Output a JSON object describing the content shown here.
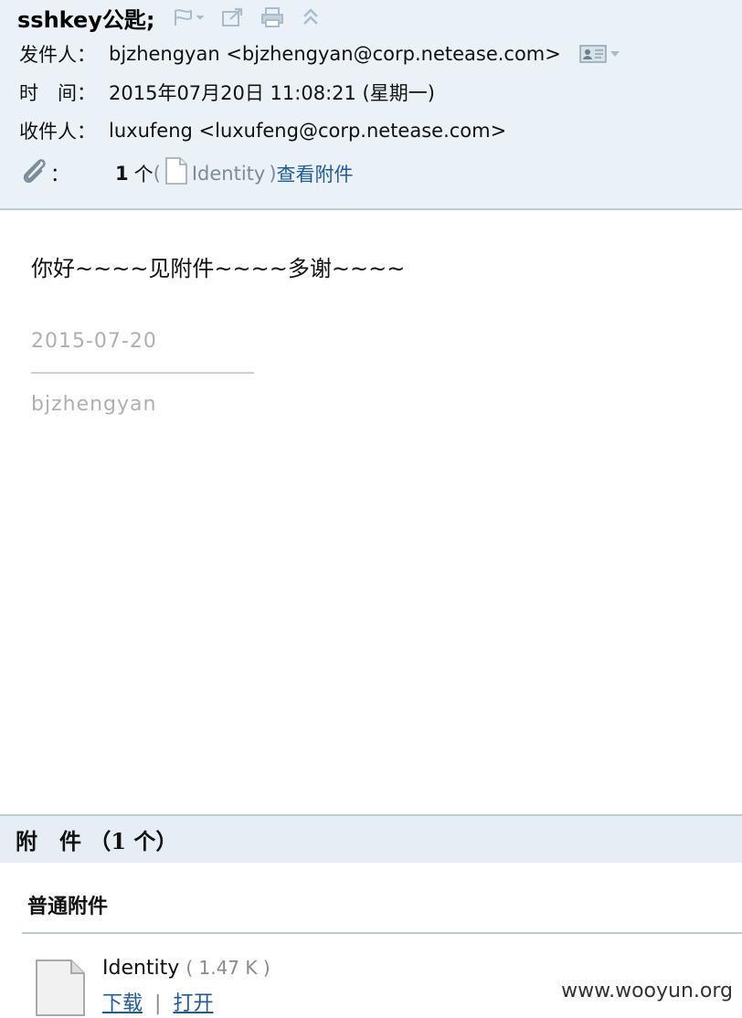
{
  "header": {
    "subject": "sshkey公匙;",
    "toolbar": {
      "flag_icon": "flag-icon",
      "popout_icon": "popout-icon",
      "print_icon": "print-icon",
      "collapse_icon": "collapse-up-icon"
    },
    "from": {
      "label": "发件人：",
      "value": "bjzhengyan <bjzhengyan@corp.netease.com>",
      "contact_icon": "contact-card-icon"
    },
    "time": {
      "label": "时　间：",
      "value": "2015年07月20日 11:08:21 (星期一)"
    },
    "to": {
      "label": "收件人：",
      "value": "luxufeng <luxufeng@corp.netease.com>"
    },
    "attachment": {
      "icon": "paperclip-icon",
      "label": "：",
      "count": "1",
      "unit": "个",
      "open_paren": "(",
      "file_name": "Identity",
      "close_paren": ")",
      "view_link": "查看附件"
    }
  },
  "body": {
    "greeting": "你好~~~~见附件~~~~多谢~~~~",
    "signature_date": "2015-07-20",
    "signature_name": "bjzhengyan"
  },
  "attachments": {
    "title": "附　件 （1 个）",
    "subtitle": "普通附件",
    "file": {
      "icon": "file-icon",
      "name": "Identity",
      "size": "( 1.47 K )",
      "download": "下载",
      "separator": "|",
      "open": "打开"
    }
  },
  "watermark": "www.wooyun.org",
  "colors": {
    "header_bg": "#eaf2f7",
    "border": "#b9ccd8",
    "link": "#1f5a9e",
    "muted": "#b0b0b0"
  }
}
